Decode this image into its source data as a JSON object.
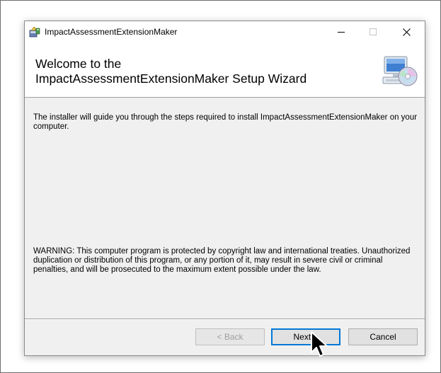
{
  "window": {
    "title": "ImpactAssessmentExtensionMaker",
    "app_icon": "installer-package-icon",
    "controls": {
      "minimize_icon": "minimize-icon",
      "maximize_icon": "maximize-icon",
      "close_icon": "close-icon"
    }
  },
  "header": {
    "title_line1": "Welcome to the",
    "title_line2": "ImpactAssessmentExtensionMaker Setup Wizard",
    "icon": "computer-cd-icon"
  },
  "body": {
    "intro": "The installer will guide you through the steps required to install ImpactAssessmentExtensionMaker on your computer.",
    "warning": "WARNING: This computer program is protected by copyright law and international treaties. Unauthorized duplication or distribution of this program, or any portion of it, may result in severe civil or criminal penalties, and will be prosecuted to the maximum extent possible under the law."
  },
  "buttons": {
    "back": "< Back",
    "next": "Next >",
    "cancel": "Cancel"
  },
  "colors": {
    "focus_border": "#0078d7",
    "dialog_background": "#f0f0f0"
  }
}
